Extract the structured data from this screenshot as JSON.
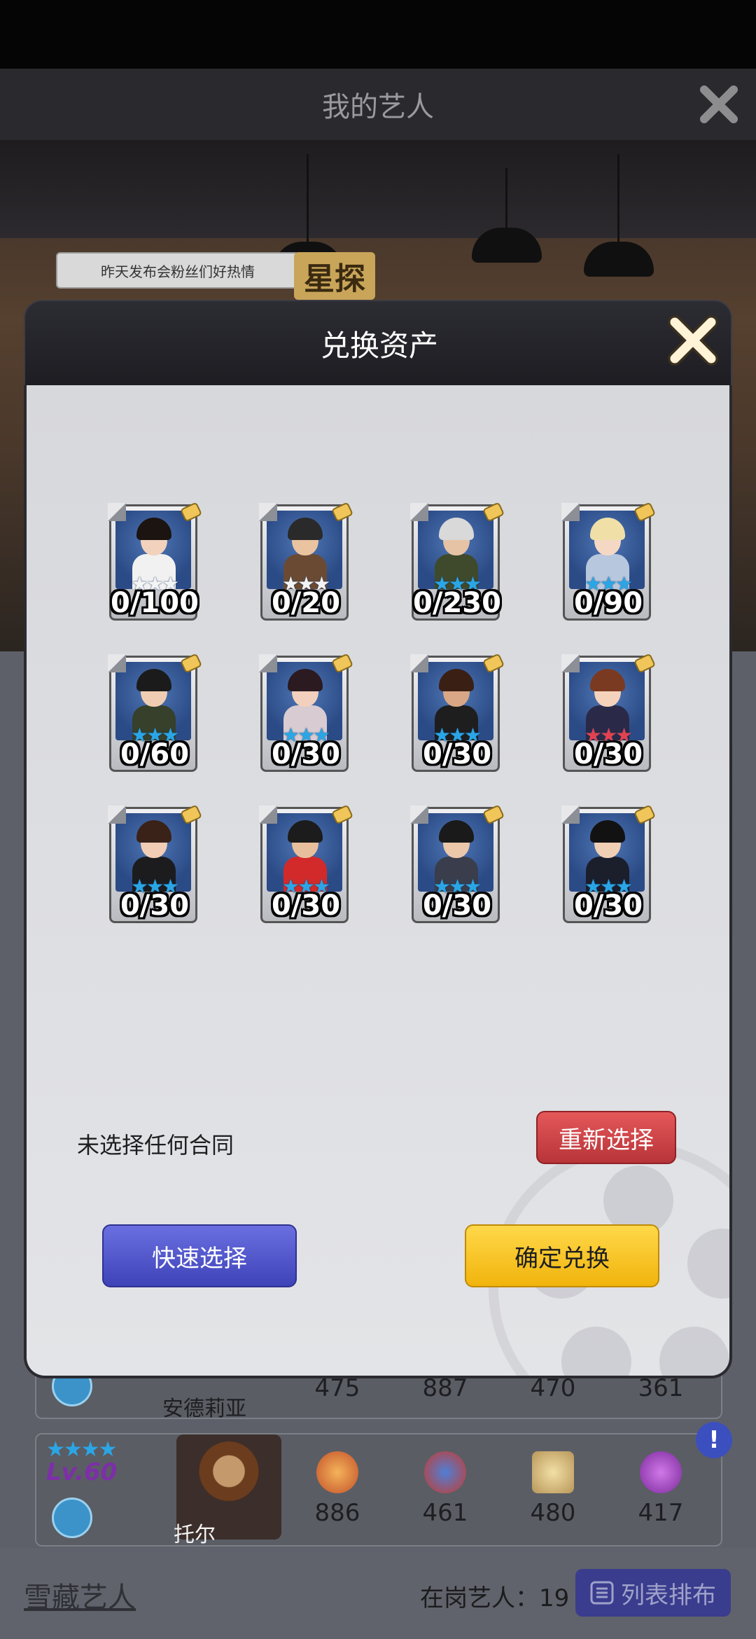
{
  "background": {
    "header_title": "我的艺人",
    "ticker_text": "昨天发布会粉丝们好热情",
    "sign_text": "星探",
    "rows": [
      {
        "name": "安德莉亚",
        "stats": [
          "475",
          "887",
          "470",
          "361"
        ]
      },
      {
        "name": "托尔",
        "level": "Lv.60",
        "stats": [
          "886",
          "461",
          "480",
          "417"
        ]
      }
    ],
    "bottom": {
      "snow_label": "雪藏艺人",
      "onduty_label": "在岗艺人：",
      "onduty_count": "19",
      "sort_label": "列表排布"
    }
  },
  "modal": {
    "title": "兑换资产",
    "cards": [
      {
        "count": "0/100",
        "stars": "white",
        "palette": "girl1"
      },
      {
        "count": "0/20",
        "stars": "white",
        "palette": "boy_glasses"
      },
      {
        "count": "0/230",
        "stars": "blue",
        "palette": "old_man"
      },
      {
        "count": "0/90",
        "stars": "blue",
        "palette": "blonde"
      },
      {
        "count": "0/60",
        "stars": "blue",
        "palette": "officer"
      },
      {
        "count": "0/30",
        "stars": "blue",
        "palette": "girl_dark"
      },
      {
        "count": "0/30",
        "stars": "blue",
        "palette": "girl_brown"
      },
      {
        "count": "0/30",
        "stars": "red",
        "palette": "girl_red"
      },
      {
        "count": "0/30",
        "stars": "blue",
        "palette": "girl_gun"
      },
      {
        "count": "0/30",
        "stars": "blue",
        "palette": "boy_red"
      },
      {
        "count": "0/30",
        "stars": "blue",
        "palette": "man_vest"
      },
      {
        "count": "0/30",
        "stars": "blue",
        "palette": "boy_suit"
      }
    ],
    "selection_status": "未选择任何合同",
    "reset_button": "重新选择",
    "quick_button": "快速选择",
    "confirm_button": "确定兑换"
  },
  "colors": {
    "star_white": "#f4f4f4",
    "star_blue": "#2aa6e6",
    "star_red": "#e2424f",
    "reset": "#c9403f",
    "quick": "#4a4fc7",
    "confirm": "#f7c21c"
  }
}
